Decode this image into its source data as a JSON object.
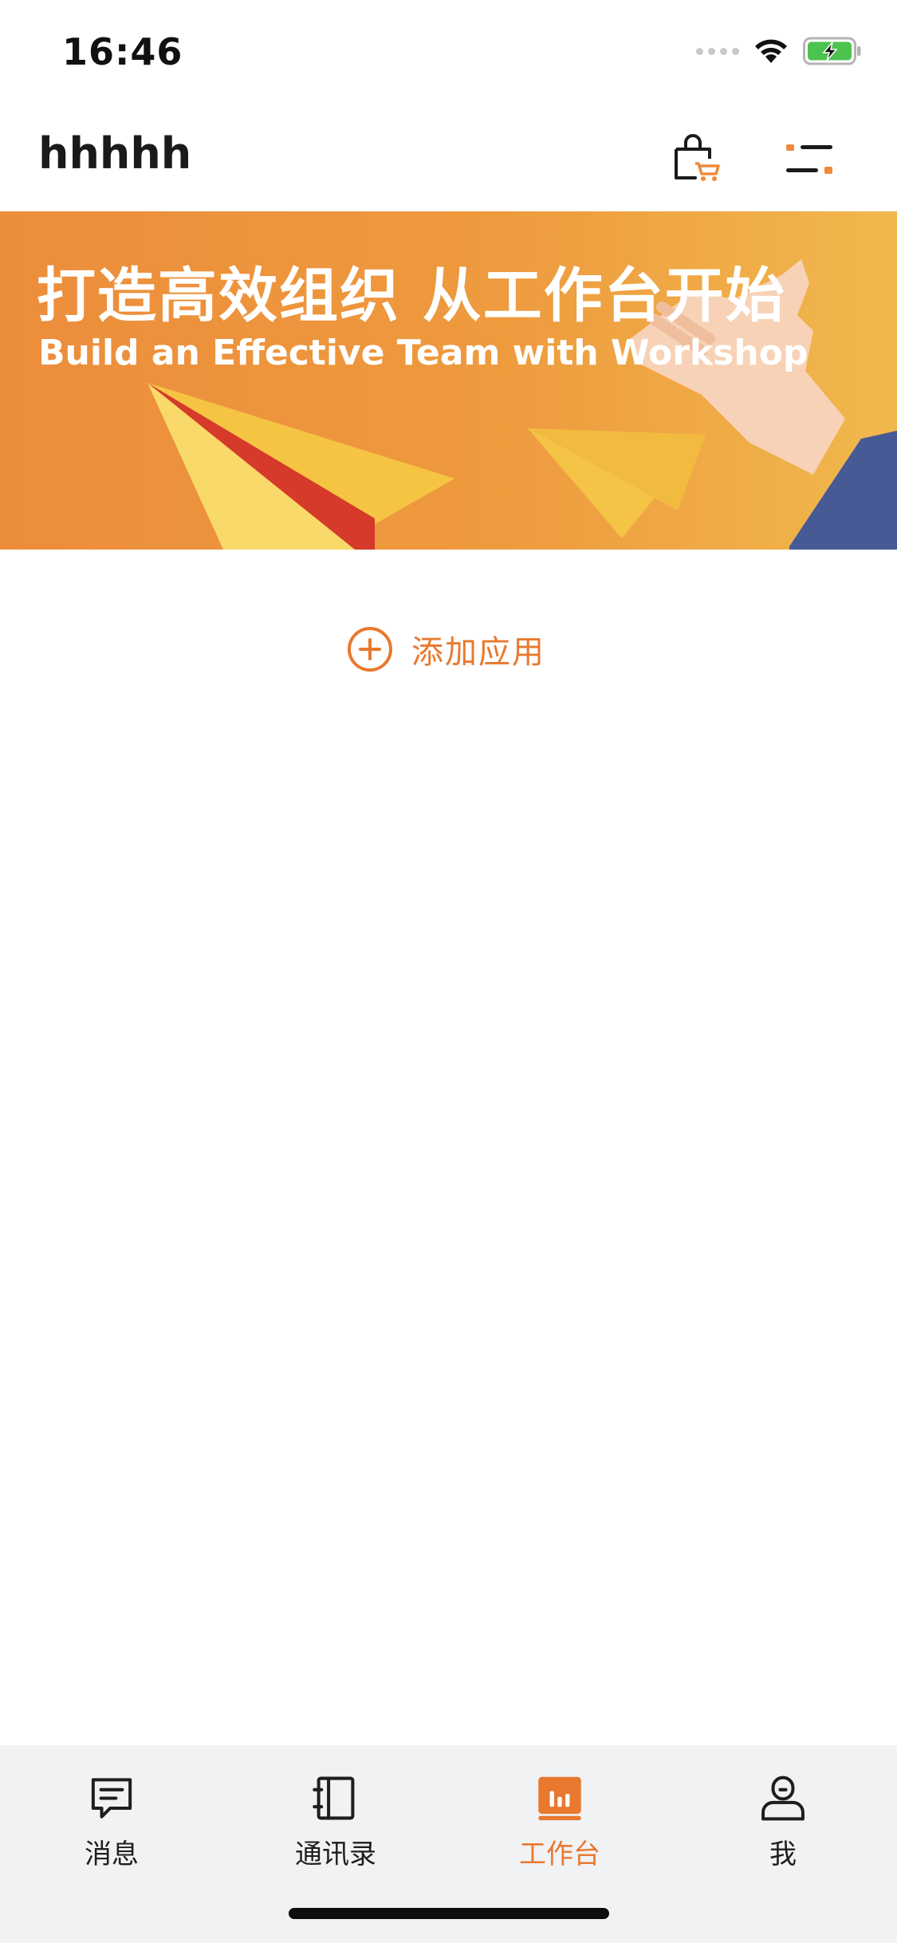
{
  "status_bar": {
    "time": "16:46",
    "icons": [
      "cellular-signal-icon",
      "wifi-icon",
      "battery-charging-icon"
    ]
  },
  "header": {
    "org_name": "hhhhh",
    "icons": [
      "shopping-bag-icon",
      "menu-icon"
    ]
  },
  "banner": {
    "title": "打造高效组织 从工作台开始",
    "subtitle": "Build an Effective Team with Workshop"
  },
  "workspace": {
    "add_app_label": "添加应用",
    "add_icon": "plus-circle-icon"
  },
  "tab_bar": {
    "tabs": [
      {
        "label": "消息",
        "icon": "message-icon",
        "active": false
      },
      {
        "label": "通讯录",
        "icon": "contacts-book-icon",
        "active": false
      },
      {
        "label": "工作台",
        "icon": "workbench-icon",
        "active": true
      },
      {
        "label": "我",
        "icon": "profile-icon",
        "active": false
      }
    ]
  },
  "colors": {
    "accent": "#e8792f",
    "banner_start": "#ec8d3b",
    "banner_end": "#f1b84d",
    "tab_bar_bg": "#f1f2f4",
    "battery_green": "#4cc24f"
  }
}
